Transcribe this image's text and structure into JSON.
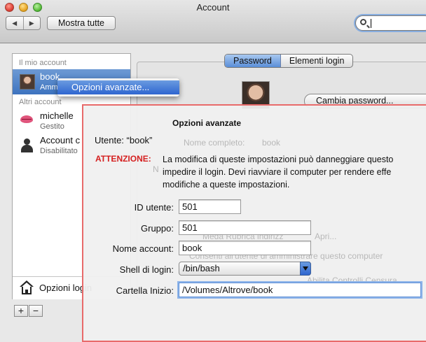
{
  "window": {
    "title": "Account"
  },
  "toolbar": {
    "back_glyph": "◀",
    "forward_glyph": "▶",
    "show_all_label": "Mostra tutte",
    "search_value": ""
  },
  "sidebar": {
    "my_account_header": "Il mio account",
    "my_account": {
      "name": "book",
      "role": "Amm"
    },
    "other_accounts_header": "Altri account",
    "others": [
      {
        "name": "michelle",
        "role": "Gestito",
        "icon": "lips-icon"
      },
      {
        "name": "Account c",
        "role": "Disabilitato",
        "icon": "user-silhouette-icon"
      }
    ],
    "login_options_label": "Opzioni login",
    "add_label": "+",
    "remove_label": "−"
  },
  "context_menu": {
    "item": "Opzioni avanzate..."
  },
  "main": {
    "tabs": [
      {
        "label": "Password",
        "active": true
      },
      {
        "label": "Elementi login",
        "active": false
      }
    ],
    "change_password_label": "Cambia password...",
    "ghost_full_name_label": "Nome completo:",
    "ghost_full_name_value": "book",
    "ghost_line_n": "N",
    "ghost_rubrica": "Meda Rubrica indirizz",
    "ghost_apri": "Apri...",
    "ghost_admin": "Consenti all'utente di amministrare questo computer",
    "ghost_controls": "Abilita Controlli Censura"
  },
  "sheet": {
    "title": "Opzioni avanzate",
    "user_line": "Utente: “book”",
    "warning_label": "ATTENZIONE:",
    "warning_lines": [
      "La modifica di queste impostazioni può danneggiare questo",
      "impedire il login. Devi riavviare il computer per rendere effe",
      "modifiche a queste impostazioni."
    ],
    "fields": {
      "user_id_label": "ID utente:",
      "user_id_value": "501",
      "group_label": "Gruppo:",
      "group_value": "501",
      "account_name_label": "Nome account:",
      "account_name_value": "book",
      "login_shell_label": "Shell di login:",
      "login_shell_value": "/bin/bash",
      "home_folder_label": "Cartella Inizio:",
      "home_folder_value": "/Volumes/Altrove/book"
    }
  }
}
